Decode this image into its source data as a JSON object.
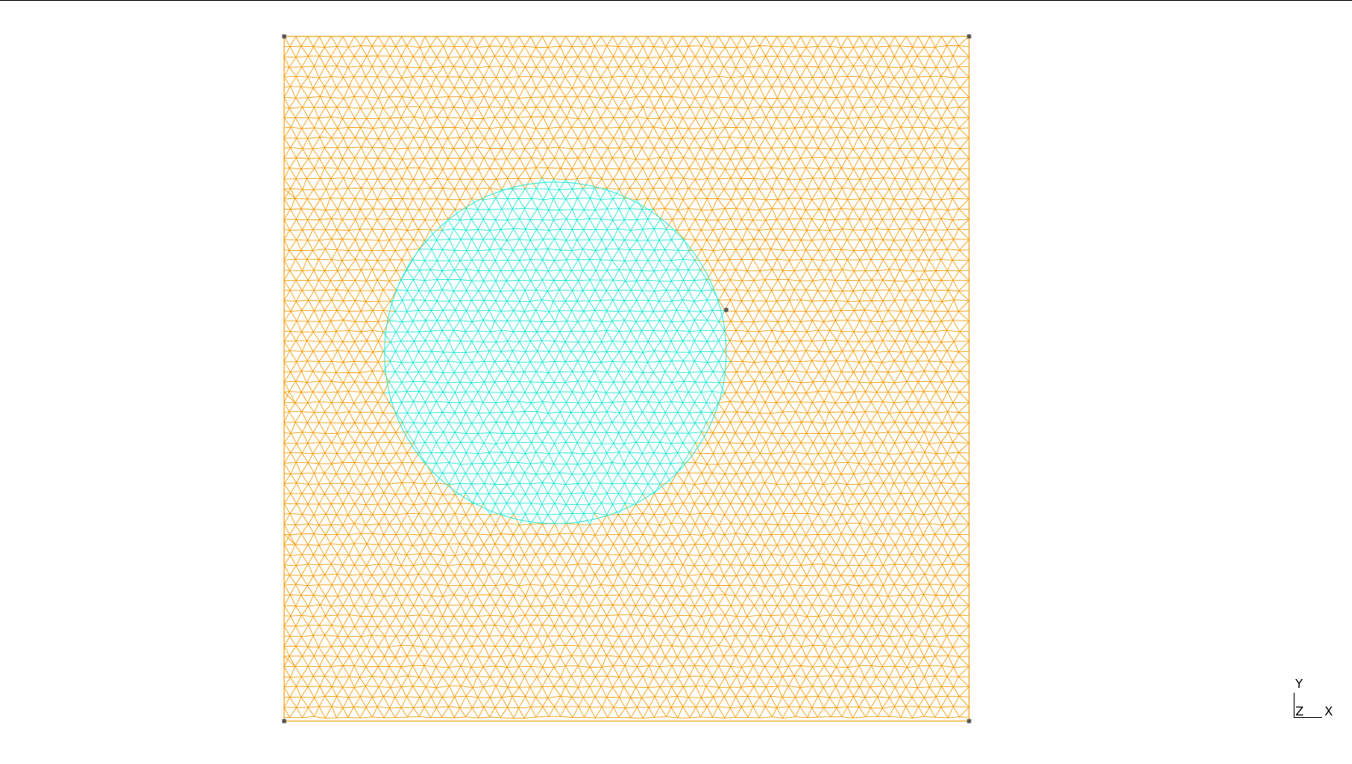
{
  "viewport": {
    "background": "#ffffff"
  },
  "mesh": {
    "element_type": "triangle",
    "outer_region_color": "#f5a31a",
    "inner_region_color": "#2ee8d4",
    "vertex_marker_color": "#555555",
    "shape": "square-with-circular-inclusion"
  },
  "axes": {
    "y_label": "Y",
    "z_label": "Z",
    "x_label": "X"
  }
}
